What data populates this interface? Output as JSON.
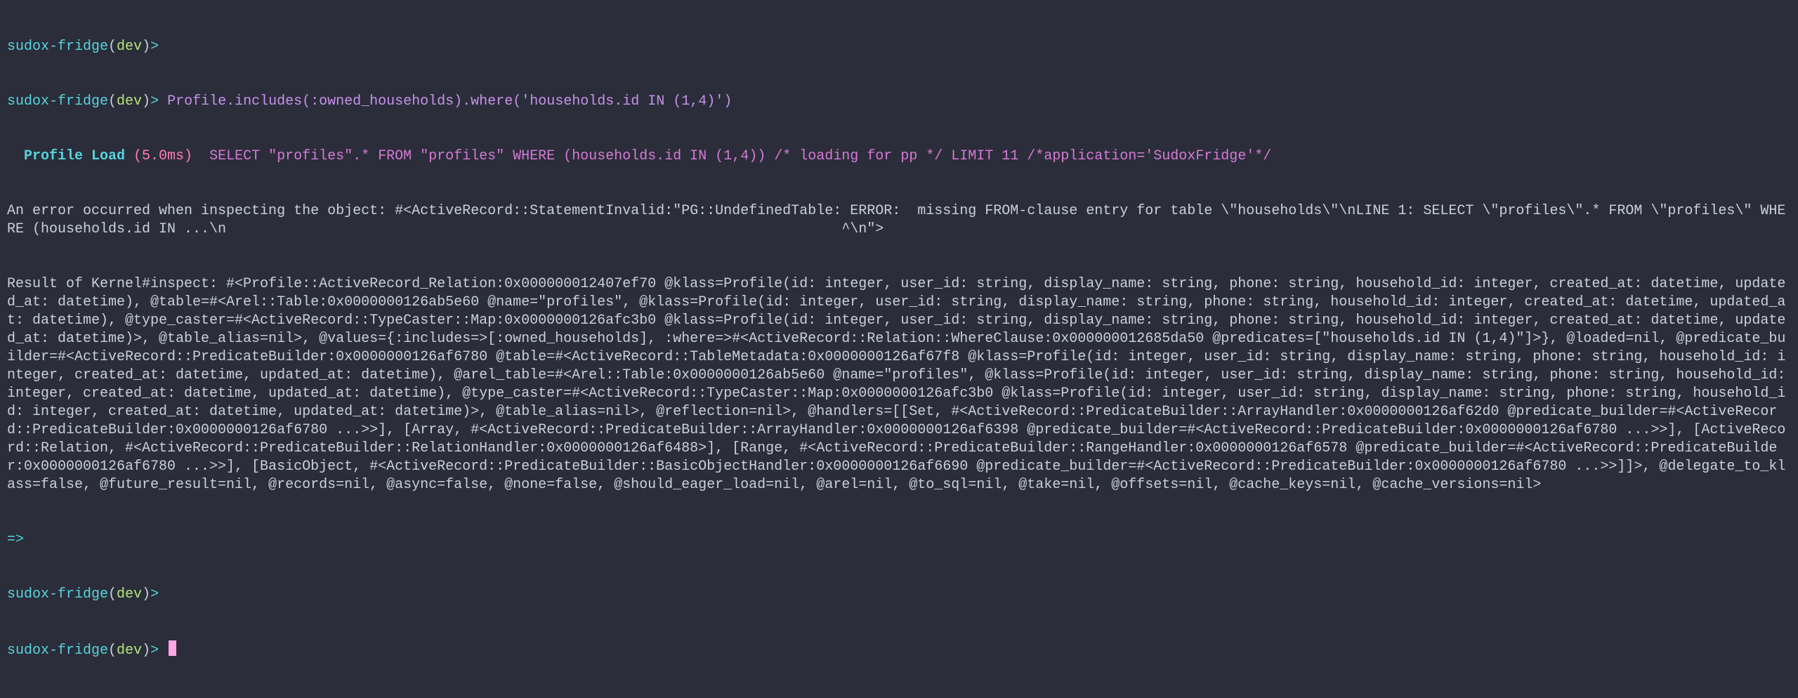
{
  "prompt": {
    "host": "sudox-fridge",
    "env": "dev",
    "sym": ">"
  },
  "lines": {
    "cmd": "Profile.includes(:owned_households).where('households.id IN (1,4)')",
    "load_label": "  Profile Load ",
    "load_ms": "(5.0ms)",
    "sql": "  SELECT \"profiles\".* FROM \"profiles\" WHERE (households.id IN (1,4)) /* loading for pp */ LIMIT 11 /*application='SudoxFridge'*/",
    "err1": "An error occurred when inspecting the object: #<ActiveRecord::StatementInvalid:\"PG::UndefinedTable: ERROR:  missing FROM-clause entry for table \\\"households\\\"\\nLINE 1: SELECT \\\"profiles\\\".* FROM \\\"profiles\\\" WHERE (households.id IN ...\\n                                                                         ^\\n\">",
    "dump": "Result of Kernel#inspect: #<Profile::ActiveRecord_Relation:0x000000012407ef70 @klass=Profile(id: integer, user_id: string, display_name: string, phone: string, household_id: integer, created_at: datetime, updated_at: datetime), @table=#<Arel::Table:0x0000000126ab5e60 @name=\"profiles\", @klass=Profile(id: integer, user_id: string, display_name: string, phone: string, household_id: integer, created_at: datetime, updated_at: datetime), @type_caster=#<ActiveRecord::TypeCaster::Map:0x0000000126afc3b0 @klass=Profile(id: integer, user_id: string, display_name: string, phone: string, household_id: integer, created_at: datetime, updated_at: datetime)>, @table_alias=nil>, @values={:includes=>[:owned_households], :where=>#<ActiveRecord::Relation::WhereClause:0x000000012685da50 @predicates=[\"households.id IN (1,4)\"]>}, @loaded=nil, @predicate_builder=#<ActiveRecord::PredicateBuilder:0x0000000126af6780 @table=#<ActiveRecord::TableMetadata:0x0000000126af67f8 @klass=Profile(id: integer, user_id: string, display_name: string, phone: string, household_id: integer, created_at: datetime, updated_at: datetime), @arel_table=#<Arel::Table:0x0000000126ab5e60 @name=\"profiles\", @klass=Profile(id: integer, user_id: string, display_name: string, phone: string, household_id: integer, created_at: datetime, updated_at: datetime), @type_caster=#<ActiveRecord::TypeCaster::Map:0x0000000126afc3b0 @klass=Profile(id: integer, user_id: string, display_name: string, phone: string, household_id: integer, created_at: datetime, updated_at: datetime)>, @table_alias=nil>, @reflection=nil>, @handlers=[[Set, #<ActiveRecord::PredicateBuilder::ArrayHandler:0x0000000126af62d0 @predicate_builder=#<ActiveRecord::PredicateBuilder:0x0000000126af6780 ...>>], [Array, #<ActiveRecord::PredicateBuilder::ArrayHandler:0x0000000126af6398 @predicate_builder=#<ActiveRecord::PredicateBuilder:0x0000000126af6780 ...>>], [ActiveRecord::Relation, #<ActiveRecord::PredicateBuilder::RelationHandler:0x0000000126af6488>], [Range, #<ActiveRecord::PredicateBuilder::RangeHandler:0x0000000126af6578 @predicate_builder=#<ActiveRecord::PredicateBuilder:0x0000000126af6780 ...>>], [BasicObject, #<ActiveRecord::PredicateBuilder::BasicObjectHandler:0x0000000126af6690 @predicate_builder=#<ActiveRecord::PredicateBuilder:0x0000000126af6780 ...>>]]>, @delegate_to_klass=false, @future_result=nil, @records=nil, @async=false, @none=false, @should_eager_load=nil, @arel=nil, @to_sql=nil, @take=nil, @offsets=nil, @cache_keys=nil, @cache_versions=nil>",
    "arrow": "=>"
  }
}
